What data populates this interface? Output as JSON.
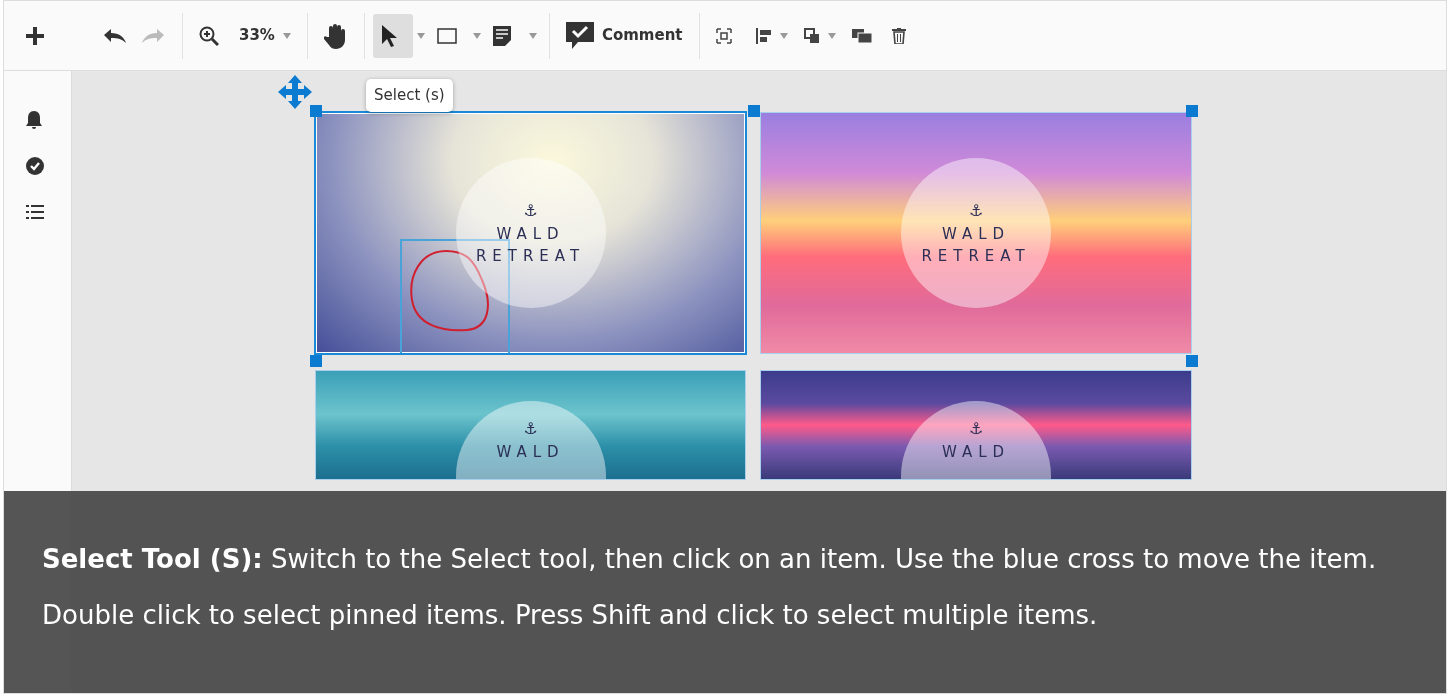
{
  "toolbar": {
    "undo": {
      "disabled": false
    },
    "redo": {
      "disabled": true
    },
    "zoom": "33%",
    "tools": [
      {
        "kind": "hand",
        "selected": false
      },
      {
        "kind": "select",
        "selected": true
      },
      {
        "kind": "rectangle",
        "selected": false
      },
      {
        "kind": "note",
        "selected": false
      }
    ],
    "comment_label": "Comment"
  },
  "tooltip": "Select (s)",
  "artboards": [
    {
      "kind": "mist",
      "selected": true,
      "anchor": "⚓",
      "line_1": "WALD",
      "line_2": "RETREAT"
    },
    {
      "kind": "sunset",
      "selected": false,
      "anchor": "⚓",
      "line_1": "WALD",
      "line_2": "RETREAT"
    },
    {
      "kind": "sea",
      "selected": false,
      "anchor": "⚓",
      "line_1": "WALD"
    },
    {
      "kind": "dusk",
      "selected": false,
      "anchor": "⚓",
      "line_1": "WALD"
    }
  ],
  "caption": "**Select Tool (S):** Switch to the Select tool, then click on an item. Use the blue cross to move the item. Double click to select pinned items. Press Shift and click to select multiple items."
}
